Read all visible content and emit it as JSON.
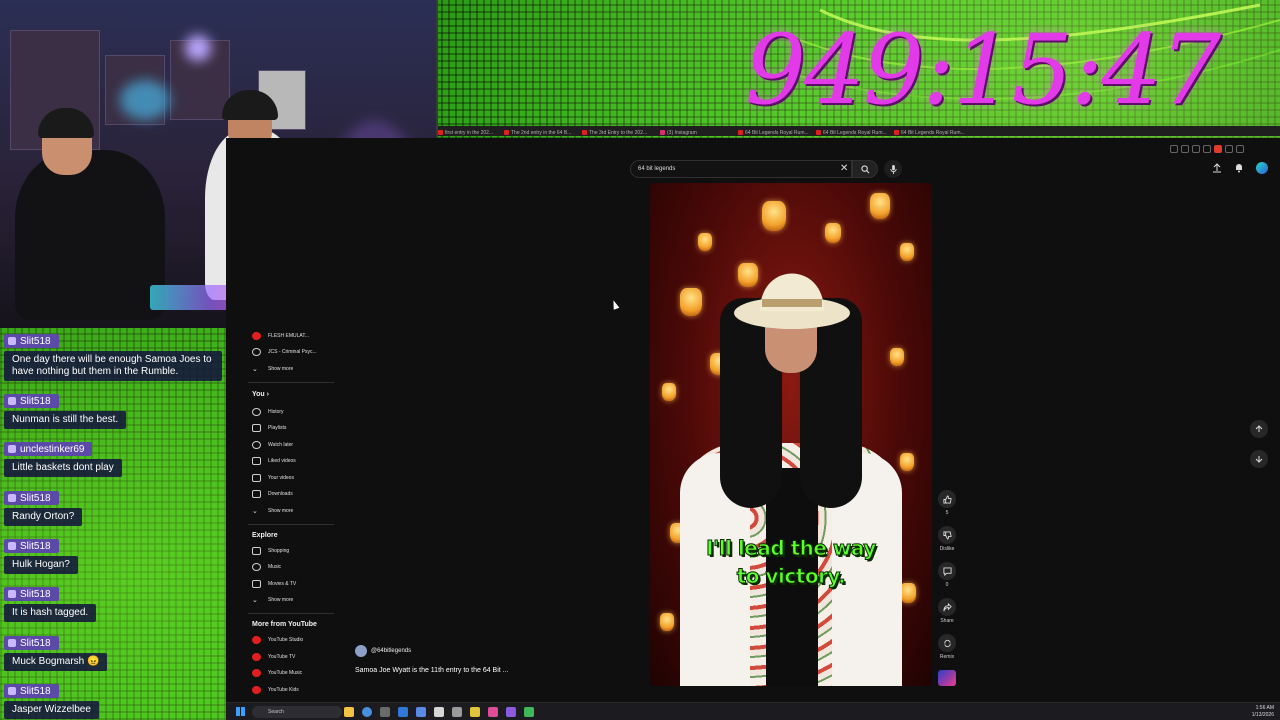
{
  "overlay": {
    "timer": "949:15:47",
    "colors": {
      "timer": "#e23ae8",
      "background": "#2fb51a",
      "chat_name_bg": "#5b4aa8"
    }
  },
  "chat": {
    "messages": [
      {
        "user": "Slit518",
        "text": "One day there will be enough Samoa Joes to have nothing but them in the Rumble."
      },
      {
        "user": "Slit518",
        "text": "Nunman is still the best."
      },
      {
        "user": "unclestinker69",
        "text": "Little baskets dont play"
      },
      {
        "user": "Slit518",
        "text": "Randy Orton?"
      },
      {
        "user": "Slit518",
        "text": "Hulk Hogan?"
      },
      {
        "user": "Slit518",
        "text": "It is hash tagged."
      },
      {
        "user": "Slit518",
        "text": "Muck Bogmarsh 😠"
      },
      {
        "user": "Slit518",
        "text": "Jasper Wizzelbee"
      }
    ]
  },
  "browser": {
    "tabs": [
      {
        "label": "first entry in the 202...",
        "icon": "youtube-icon"
      },
      {
        "label": "The 2nd entry in the 64 B...",
        "icon": "youtube-icon"
      },
      {
        "label": "The 3rd Entry to the 202...",
        "icon": "youtube-icon"
      },
      {
        "label": "(3) Instagram",
        "icon": "instagram-icon"
      },
      {
        "label": "64 Bit Legends Royal Rum...",
        "icon": "youtube-icon"
      },
      {
        "label": "64 Bit Legends Royal Rum...",
        "icon": "youtube-icon"
      },
      {
        "label": "64 Bit Legends Royal Rum...",
        "icon": "youtube-icon"
      }
    ]
  },
  "youtube": {
    "search": {
      "value": "64 bit legends"
    },
    "sidebar": {
      "subscriptions": [
        {
          "label": "FLESH EMULAT...",
          "icon": "channel-avatar-icon"
        },
        {
          "label": "JCS - Criminal Psyc...",
          "icon": "channel-avatar-icon"
        }
      ],
      "show_more_1": "Show more",
      "you_heading": "You",
      "you_items": [
        {
          "label": "History",
          "icon": "history-icon"
        },
        {
          "label": "Playlists",
          "icon": "playlists-icon"
        },
        {
          "label": "Watch later",
          "icon": "watch-later-icon"
        },
        {
          "label": "Liked videos",
          "icon": "liked-videos-icon"
        },
        {
          "label": "Your videos",
          "icon": "your-videos-icon"
        },
        {
          "label": "Downloads",
          "icon": "downloads-icon"
        }
      ],
      "show_more_2": "Show more",
      "explore_heading": "Explore",
      "explore_items": [
        {
          "label": "Shopping",
          "icon": "shopping-icon"
        },
        {
          "label": "Music",
          "icon": "music-icon"
        },
        {
          "label": "Movies & TV",
          "icon": "movies-icon"
        }
      ],
      "show_more_3": "Show more",
      "more_heading": "More from YouTube",
      "more_items": [
        {
          "label": "YouTube Studio",
          "icon": "youtube-studio-icon"
        },
        {
          "label": "YouTube TV",
          "icon": "youtube-tv-icon"
        },
        {
          "label": "YouTube Music",
          "icon": "youtube-music-icon"
        },
        {
          "label": "YouTube Kids",
          "icon": "youtube-kids-icon"
        }
      ]
    },
    "short": {
      "caption": "I'll lead the way\nto victory.",
      "channel": "@64bitlegends",
      "title": "Samoa Joe Wyatt is the 11th entry to the 64 Bit ..."
    },
    "actions": {
      "like_count": "5",
      "dislike_label": "Dislike",
      "comment_count": "0",
      "share_label": "Share",
      "remix_label": "Remix"
    }
  },
  "taskbar": {
    "search_placeholder": "Search",
    "time": "1:56 AM",
    "date": "1/13/2026"
  }
}
